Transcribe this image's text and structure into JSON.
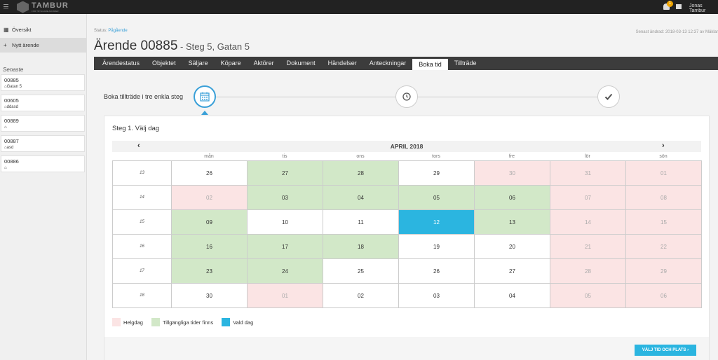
{
  "topbar": {
    "brand": "TAMBUR",
    "brand_sub": "FÖR TRYGGARE AFFÄRER",
    "notification_count": "1",
    "user": "Jonas Tambur"
  },
  "sidebar": {
    "items": [
      {
        "label": "Översikt",
        "icon": "grid-icon"
      },
      {
        "label": "Nytt ärende",
        "icon": "plus-icon"
      }
    ],
    "recent_heading": "Senaste",
    "recent": [
      {
        "number": "00885",
        "address": "Gatan 5"
      },
      {
        "number": "00605",
        "address": "ddasd"
      },
      {
        "number": "00889",
        "address": ""
      },
      {
        "number": "00887",
        "address": "asd"
      },
      {
        "number": "00886",
        "address": ""
      }
    ]
  },
  "page": {
    "status_label": "Status:",
    "status_value": "Pågående",
    "last_modified": "Senast ändrad: 2018-03-13 12:37 av Mäklar",
    "title": "Ärende 00885",
    "subtitle": " - Steg 5, Gatan 5"
  },
  "tabs": [
    "Ärendestatus",
    "Objektet",
    "Säljare",
    "Köpare",
    "Aktörer",
    "Dokument",
    "Händelser",
    "Anteckningar",
    "Boka tid",
    "Tillträde"
  ],
  "active_tab": "Boka tid",
  "stepper": {
    "label": "Boka tillträde i tre enkla steg"
  },
  "calendar": {
    "step_heading": "Steg 1. Välj dag",
    "month": "APRIL 2018",
    "prev": "‹",
    "next": "›",
    "weekdays": [
      "mån",
      "tis",
      "ons",
      "tors",
      "fre",
      "lör",
      "sön"
    ],
    "weeks": [
      {
        "week": "13",
        "days": [
          [
            "26",
            ""
          ],
          [
            "27",
            "av"
          ],
          [
            "28",
            "av"
          ],
          [
            "29",
            ""
          ],
          [
            "30",
            "we"
          ],
          [
            "31",
            "we"
          ],
          [
            "01",
            "we"
          ]
        ]
      },
      {
        "week": "14",
        "days": [
          [
            "02",
            "we"
          ],
          [
            "03",
            "av"
          ],
          [
            "04",
            "av"
          ],
          [
            "05",
            "av"
          ],
          [
            "06",
            "av"
          ],
          [
            "07",
            "we"
          ],
          [
            "08",
            "we"
          ]
        ]
      },
      {
        "week": "15",
        "days": [
          [
            "09",
            "av"
          ],
          [
            "10",
            ""
          ],
          [
            "11",
            ""
          ],
          [
            "12",
            "sel"
          ],
          [
            "13",
            "av"
          ],
          [
            "14",
            "we"
          ],
          [
            "15",
            "we"
          ]
        ]
      },
      {
        "week": "16",
        "days": [
          [
            "16",
            "av"
          ],
          [
            "17",
            "av"
          ],
          [
            "18",
            "av"
          ],
          [
            "19",
            ""
          ],
          [
            "20",
            ""
          ],
          [
            "21",
            "we"
          ],
          [
            "22",
            "we"
          ]
        ]
      },
      {
        "week": "17",
        "days": [
          [
            "23",
            "av"
          ],
          [
            "24",
            "av"
          ],
          [
            "25",
            ""
          ],
          [
            "26",
            ""
          ],
          [
            "27",
            ""
          ],
          [
            "28",
            "we"
          ],
          [
            "29",
            "we"
          ]
        ]
      },
      {
        "week": "18",
        "days": [
          [
            "30",
            ""
          ],
          [
            "01",
            "we"
          ],
          [
            "02",
            ""
          ],
          [
            "03",
            ""
          ],
          [
            "04",
            ""
          ],
          [
            "05",
            "we"
          ],
          [
            "06",
            "we"
          ]
        ]
      }
    ]
  },
  "legend": [
    {
      "label": "Helgdag",
      "color": "#fbe4e4"
    },
    {
      "label": "Tillgängliga tider finns",
      "color": "#d2e8c8"
    },
    {
      "label": "Vald dag",
      "color": "#2bb5e0"
    }
  ],
  "actions": {
    "next_button": "VÄLJ TID OCH PLATS  ›"
  }
}
